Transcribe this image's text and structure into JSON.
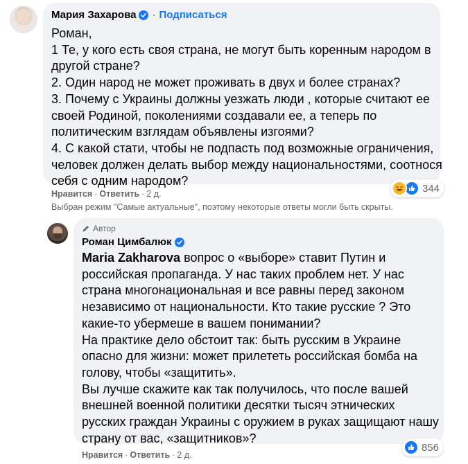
{
  "comment1": {
    "author": "Мария Захарова",
    "separator": "·",
    "follow": "Подписаться",
    "lines": [
      "Роман,",
      "1 Те, у кого есть своя страна, не могут быть коренным народом в",
      "другой стране?",
      "2. Один народ не может проживать в двух и более странах?",
      "3. Почему с Украины должны уезжать люди , которые считают ее",
      "своей Родиной, поколениями создавали ее, а теперь по",
      "политическим взглядам объявлены изгоями?",
      "4. С какой стати, чтобы не подпасть под возможные ограничения,",
      "человек должен делать выбор между национальностями, соотнося",
      "себя с одним народом?"
    ],
    "reactions": {
      "count": "344",
      "icons": [
        "haha-icon",
        "like-icon"
      ]
    },
    "actions": {
      "like": "Нравится",
      "reply": "Ответить",
      "time": "2 д.",
      "dot": "·"
    }
  },
  "notice": "Выбран режим \"Самые актуальные\", поэтому некоторые ответы могли быть скрыты.",
  "reply": {
    "badge": "Автор",
    "author": "Роман Цимбалюк",
    "mention": "Maria Zakharova",
    "first_line_rest": " вопрос о «выборе» ставит Путин и",
    "lines": [
      "российская пропаганда. У нас таких проблем нет. У нас",
      "страна многонациональная и все равны перед законом",
      "независимо от национальности. Кто такие русские ? Это",
      "какие-то убермеше в вашем понимании?",
      "На практике дело обстоит так: быть русским в Украине",
      "опасно для жизни: может прилететь российская бомба на",
      "голову, чтобы «защитить».",
      "Вы лучше скажите как так получилось, что после вашей",
      "внешней военной политики десятки тысяч этнических",
      "русских граждан Украины с оружием в руках защищают нашу",
      "страну от вас, «защитников»?"
    ],
    "reactions": {
      "count": "856",
      "icons": [
        "like-icon"
      ]
    },
    "actions": {
      "like": "Нравится",
      "reply": "Ответить",
      "time": "2 д.",
      "dot": "·"
    }
  },
  "colors": {
    "link": "#1877f2",
    "bubble": "#f0f2f5",
    "muted": "#65676b",
    "text": "#050505"
  }
}
